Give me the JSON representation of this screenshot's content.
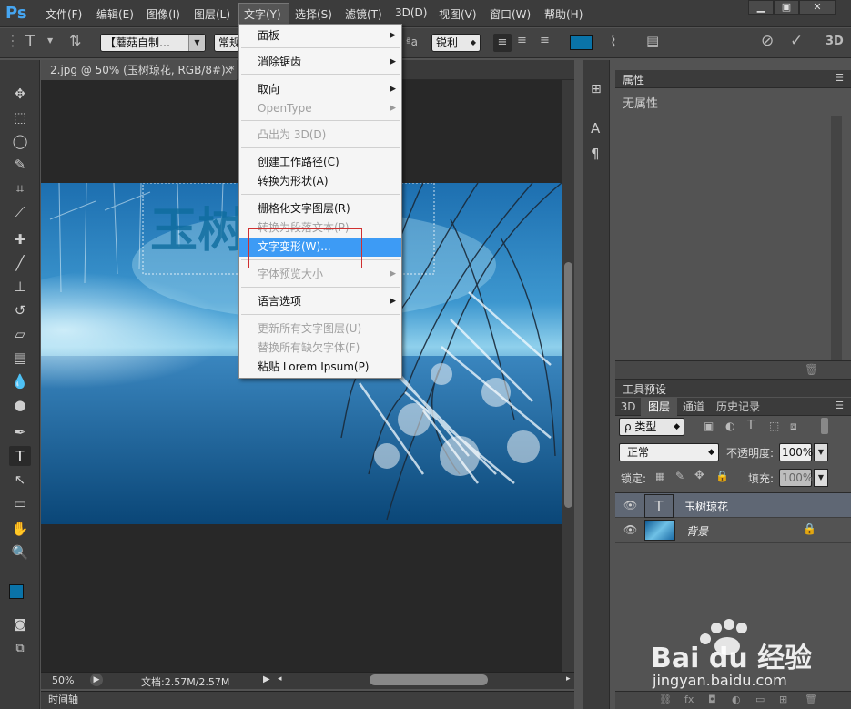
{
  "app": {
    "logo": "Ps",
    "menus": [
      "文件(F)",
      "编辑(E)",
      "图像(I)",
      "图层(L)",
      "文字(Y)",
      "选择(S)",
      "滤镜(T)",
      "3D(D)",
      "视图(V)",
      "窗口(W)",
      "帮助(H)"
    ]
  },
  "options": {
    "font_family": "【蘑菇自制…",
    "font_style": "常规",
    "aa_label": "ªa",
    "antialias": "锐利",
    "panel_3d": "3D",
    "color_swatch": "#0a73a8"
  },
  "document": {
    "tab_title": "2.jpg @ 50% (玉树琼花, RGB/8#) *",
    "zoom": "50%",
    "doc_size": "文档:2.57M/2.57M",
    "timeline_label": "时间轴",
    "text_layer_preview": "玉树琼花"
  },
  "text_menu": {
    "items": [
      {
        "label": "面板",
        "submenu": true,
        "disabled": false
      },
      {
        "label": "消除锯齿",
        "submenu": true,
        "disabled": false
      },
      {
        "label": "取向",
        "submenu": true,
        "disabled": false
      },
      {
        "label": "OpenType",
        "submenu": true,
        "disabled": true
      },
      {
        "label": "凸出为 3D(D)",
        "submenu": false,
        "disabled": true
      },
      {
        "label": "创建工作路径(C)",
        "submenu": false,
        "disabled": false
      },
      {
        "label": "转换为形状(A)",
        "submenu": false,
        "disabled": false
      },
      {
        "label": "栅格化文字图层(R)",
        "submenu": false,
        "disabled": false
      },
      {
        "label": "转换为段落文本(P)",
        "submenu": false,
        "disabled": true
      },
      {
        "label": "文字变形(W)...",
        "submenu": false,
        "disabled": false,
        "highlighted": true
      },
      {
        "label": "字体预览大小",
        "submenu": true,
        "disabled": true
      },
      {
        "label": "语言选项",
        "submenu": true,
        "disabled": false
      },
      {
        "label": "更新所有文字图层(U)",
        "submenu": false,
        "disabled": true
      },
      {
        "label": "替换所有缺欠字体(F)",
        "submenu": false,
        "disabled": true
      },
      {
        "label": "粘贴 Lorem Ipsum(P)",
        "submenu": false,
        "disabled": false
      }
    ]
  },
  "properties_panel": {
    "title": "属性",
    "empty_text": "无属性"
  },
  "presets_panel": {
    "title": "工具预设"
  },
  "layers_panel": {
    "tabs": [
      "3D",
      "图层",
      "通道",
      "历史记录"
    ],
    "filter_kind": "ρ 类型",
    "blend_mode": "正常",
    "opacity_label": "不透明度:",
    "opacity_value": "100%",
    "lock_label": "锁定:",
    "fill_label": "填充:",
    "fill_value": "100%",
    "layers": [
      {
        "name": "玉树琼花",
        "type": "text",
        "thumb_glyph": "T",
        "selected": true
      },
      {
        "name": "背景",
        "type": "image",
        "locked": true,
        "selected": false
      }
    ]
  },
  "watermark": {
    "brand": "Bai du 经验",
    "url": "jingyan.baidu.com"
  }
}
